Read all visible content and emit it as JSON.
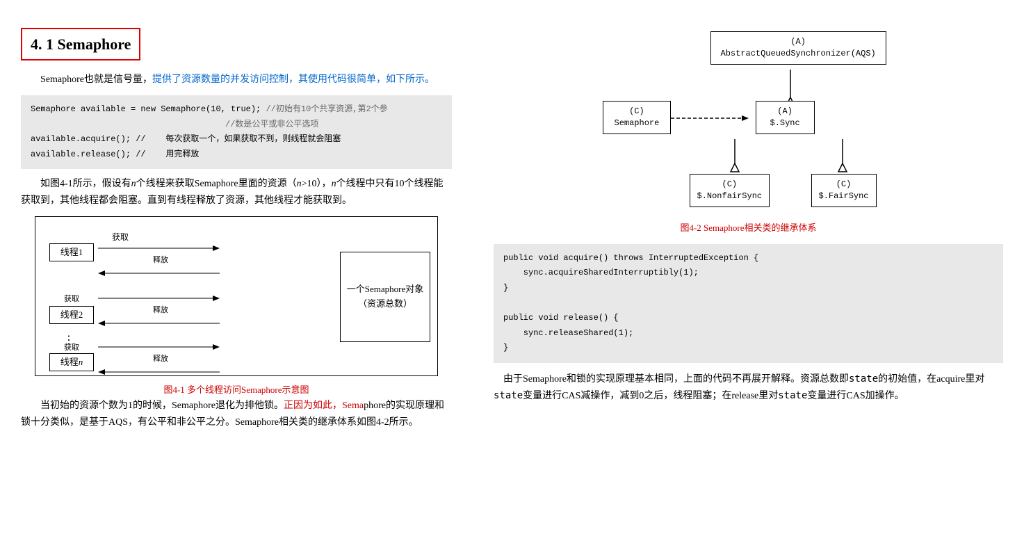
{
  "left": {
    "title": "4. 1  Semaphore",
    "para1": "Semaphore也就是信号量，提供了资源数量的并发访问控制，其使用代码很简单，如下所示。",
    "code1_lines": [
      "Semaphore available = new Semaphore(10, true); //初始有10个共享资源,第2个参",
      "                                                //数是公平或非公平选项",
      "available.acquire(); //    每次获取一个，如果获取不到，则线程就会阻塞",
      "available.release(); //    用完释放"
    ],
    "para2": "如图4-1所示，假设有n个线程来获取Semaphore里面的资源（n&gt;10），n个线程中只有10个线程能获取到，其他线程都会阻塞。直到有线程释放了资源，其他线程才能获取到。",
    "diagram_label_get": "获取",
    "diagram_label_release": "释放",
    "diagram_threads": [
      "线程1",
      "线程2",
      "⋮",
      "线程n"
    ],
    "diagram_semaphore_label": "一个Semaphore对象（资源总数）",
    "caption1": "图4-1  多个线程访问Semaphore示意图",
    "para3_part1": "当初始的资源个数为1的时候，Semaphore退化为排他锁。",
    "para3_part2": "正因为如此，Semaphore的实现原理和锁十分类似，是基于AQS，有公平和非公平之分。Semaphore相关类的继承体系如图4-2所示。"
  },
  "right": {
    "caption2": "图4-2  Semaphore相关类的继承体系",
    "inh": {
      "aqs": "(A)\nAbstractQueuedSynchronizer(AQS)",
      "sync": "(A)\n$.Sync",
      "semaphore": "(C)\nSemaphore",
      "nonfair": "(C)\n$.NonfairSync",
      "fair": "(C)\n$.FairSync"
    },
    "code2_lines": [
      "public void acquire() throws InterruptedException {",
      "    sync.acquireSharedInterruptibly(1);",
      "}",
      "",
      "public void release() {",
      "    sync.releaseShared(1);",
      "}"
    ],
    "para4": "由于Semaphore和锁的实现原理基本相同，上面的代码不再展开解释。资源总数即state的初始值，在acquire里对state变量进行CAS减操作，减到0之后，线程阻塞；在release里对state变量进行CAS加操作。"
  }
}
